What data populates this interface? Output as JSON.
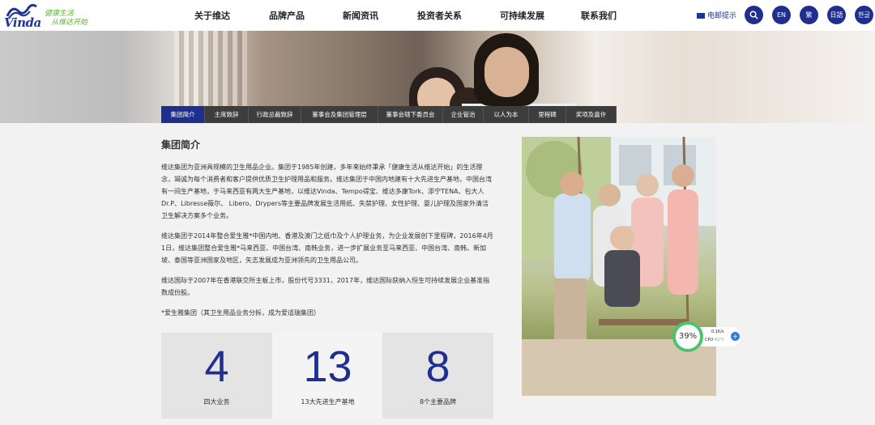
{
  "header": {
    "logo_text": "Vinda",
    "slogan_line1": "健康生活",
    "slogan_line2": "从维达开始",
    "nav": [
      "关于维达",
      "品牌产品",
      "新闻资讯",
      "投资者关系",
      "可持续发展",
      "联系我们"
    ],
    "mail_label": "电邮提示",
    "lang_buttons": [
      "EN",
      "繁",
      "日語",
      "한글"
    ]
  },
  "subnav": {
    "tabs": [
      "集团简介",
      "主席致辞",
      "行政总裁致辞",
      "董事会及集团管理层",
      "董事会辖下委员会",
      "企业管治",
      "以人为本",
      "里程碑",
      "奖项及嘉许"
    ],
    "active_index": 0
  },
  "content": {
    "title": "集团简介",
    "paragraphs": [
      "维达集团为亚洲具规模的卫生用品企业。集团于1985年创建，多年来始终秉承「健康生活从维达开始」的生活理念，竭诚为每个消费者和客户提供优质卫生护理用品和服务。维达集团于中国内地建有十大先进生产基地，中国台湾有一间生产基地，于马来西亚有两大生产基地，以维达Vinda、Tempo得宝、维达多康Tork、添宁TENA、包大人Dr.P、Libresse薇尔、 Libero、Drypers等主要品牌发展生活用纸、失禁护理、女性护理、婴儿护理及国家外清洁卫生解决方案多个业务。",
      "维达集团于2014年整合爱生雅*中国内地、香港及澳门之纸巾及个人护理业务，为企业发展创下里程碑，2016年4月1日，维达集团整合爱生雅*马来西亚、中国台湾、南韩业务，进一步扩展业务至马来西亚、中国台湾、南韩、新加坡、泰国等亚洲国家及地区，矢志发展成为亚洲领先的卫生用品公司。",
      "维达国际于2007年在香港联交所主板上市，股份代号3331，2017年，维达国际获纳入恒生可持续发展企业基准指数成份股。",
      "*爱生雅集团（其卫生用品业务分拆，成为爱适瑞集团）"
    ]
  },
  "stats": [
    {
      "value": "4",
      "label": "四大业务"
    },
    {
      "value": "13",
      "label": "13大先进生产基地"
    },
    {
      "value": "8",
      "label": "8个主要品牌"
    }
  ],
  "widget": {
    "percent": "39%",
    "speed": "0.1K/s",
    "cpu_label": "CPU",
    "cpu_temp": "42°C",
    "plus": "+"
  },
  "colors": {
    "brand_blue": "#1f2f8f",
    "active_tab": "#1f2f8f",
    "subnav_bg": "#3d3d3d",
    "stat_number": "#1f2f8f",
    "slogan_green": "#5cb531",
    "widget_green": "#4cc46e"
  },
  "icons": [
    "envelope-icon",
    "search-icon"
  ]
}
